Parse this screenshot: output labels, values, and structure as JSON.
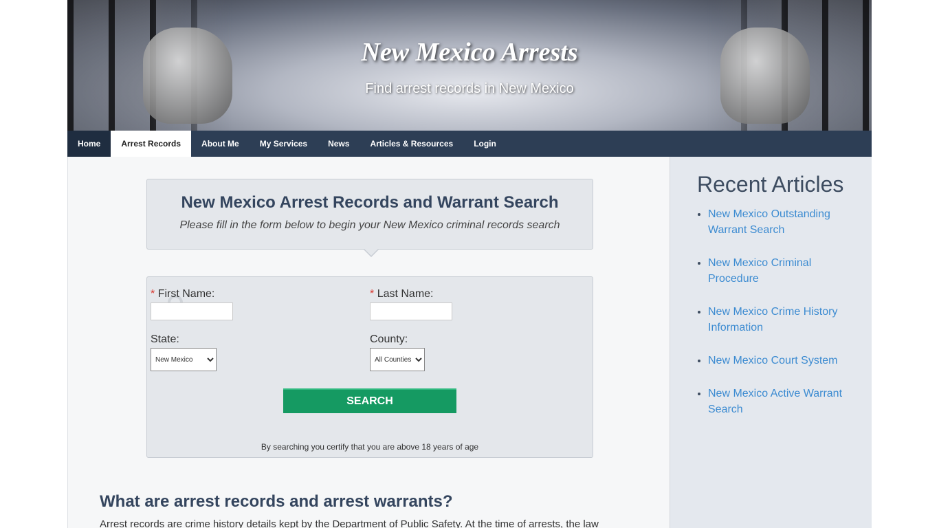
{
  "header": {
    "title": "New Mexico Arrests",
    "tagline": "Find arrest records in New Mexico"
  },
  "nav": {
    "items": [
      {
        "label": "Home"
      },
      {
        "label": "Arrest Records"
      },
      {
        "label": "About Me"
      },
      {
        "label": "My Services"
      },
      {
        "label": "News"
      },
      {
        "label": "Articles & Resources"
      },
      {
        "label": "Login"
      }
    ],
    "active": "Arrest Records"
  },
  "search": {
    "title": "New Mexico Arrest Records and Warrant Search",
    "subtitle": "Please fill in the form below to begin your New Mexico criminal records search",
    "required_mark": "*",
    "first_name_label": "First Name:",
    "last_name_label": "Last Name:",
    "first_name_value": "",
    "last_name_value": "",
    "state_label": "State:",
    "state_value": "New Mexico",
    "county_label": "County:",
    "county_value": "All Counties",
    "button_label": "SEARCH",
    "disclaimer": "By searching you certify that you are above 18 years of age"
  },
  "content": {
    "heading": "What are arrest records and arrest warrants?",
    "body": "Arrest records are crime history details kept by the Department of Public Safety. At the time of arrests, the law"
  },
  "sidebar": {
    "title": "Recent Articles",
    "articles": [
      {
        "label": "New Mexico Outstanding Warrant Search"
      },
      {
        "label": "New Mexico Criminal Procedure"
      },
      {
        "label": "New Mexico Crime History Information"
      },
      {
        "label": "New Mexico Court System"
      },
      {
        "label": "New Mexico Active Warrant Search"
      }
    ]
  },
  "colors": {
    "nav_bg": "#2d3e55",
    "heading": "#34455e",
    "button": "#159a62",
    "link": "#3c8bd1",
    "required": "#d9342b"
  }
}
